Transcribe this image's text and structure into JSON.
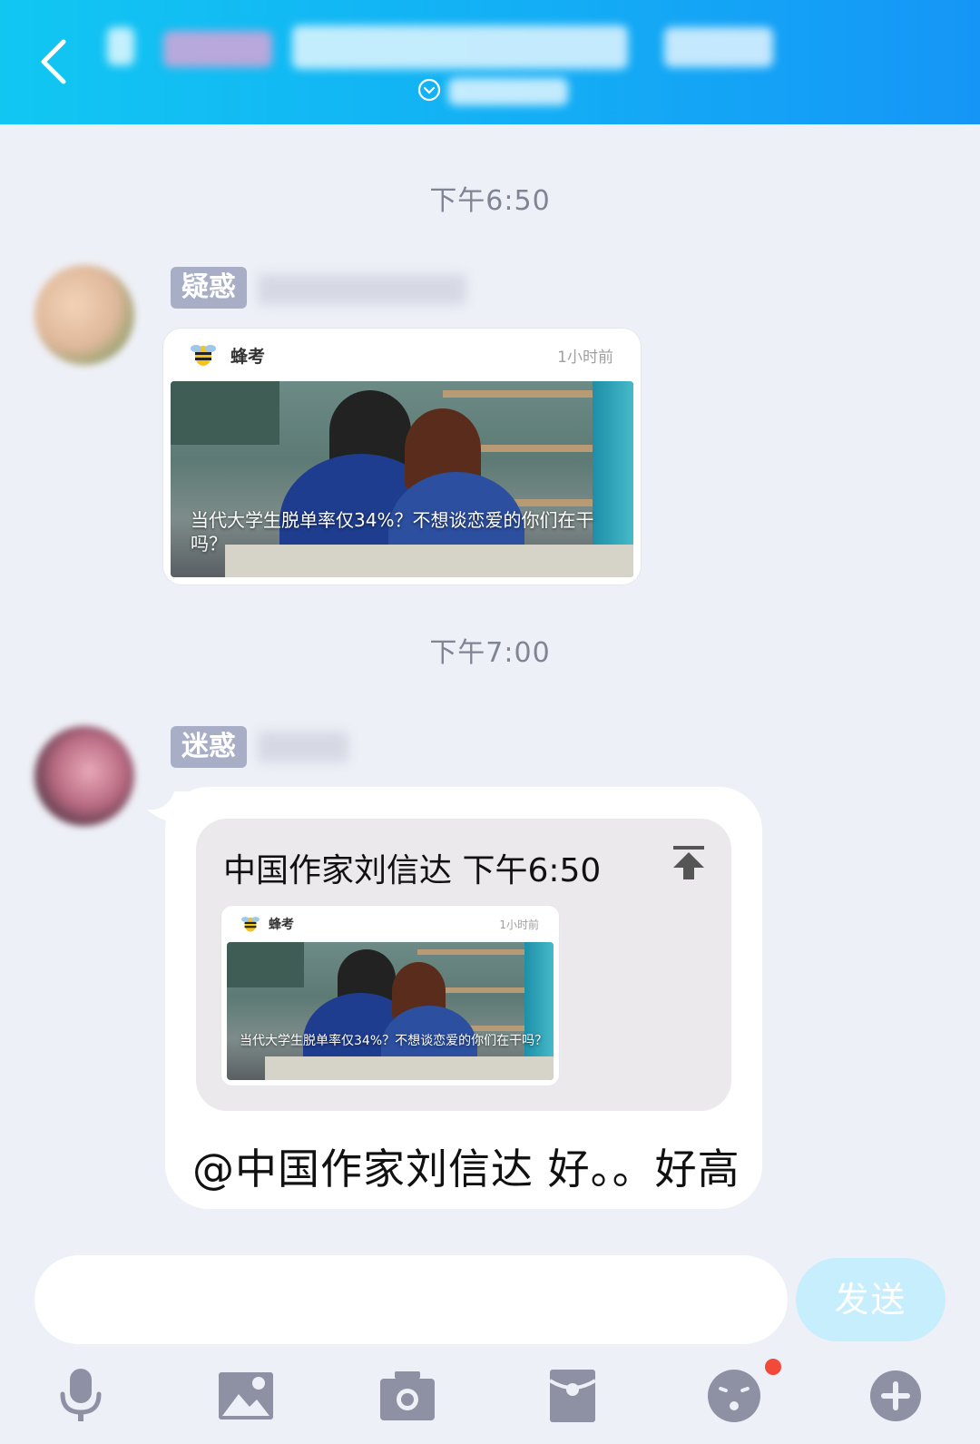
{
  "header": {
    "title": "",
    "subtitle": ""
  },
  "messages": [
    {
      "timestamp": "下午6:50",
      "sender_badge": "疑惑",
      "card": {
        "source": "蜂考",
        "time_ago": "1小时前",
        "caption": "当代大学生脱单率仅34%？不想谈恋爱的你们在干吗？"
      }
    },
    {
      "timestamp": "下午7:00",
      "sender_badge": "迷惑",
      "quote": {
        "header": "中国作家刘信达 下午6:50",
        "card": {
          "source": "蜂考",
          "time_ago": "1小时前",
          "caption": "当代大学生脱单率仅34%？不想谈恋爱的你们在干吗？"
        }
      },
      "text": "@中国作家刘信达 好。。好高"
    }
  ],
  "composer": {
    "placeholder": "",
    "send_label": "发送"
  },
  "toolbar": {
    "icons": [
      "microphone-icon",
      "image-icon",
      "camera-icon",
      "red-packet-icon",
      "emoji-icon",
      "plus-icon"
    ]
  },
  "colors": {
    "header_gradient_start": "#11c7f2",
    "header_gradient_end": "#1596f6",
    "background": "#eef0f7",
    "badge_bg": "#a9aec7",
    "send_button": "#c7eefc",
    "notification_dot": "#f24a3a",
    "icon_gray": "#8d91a3"
  }
}
